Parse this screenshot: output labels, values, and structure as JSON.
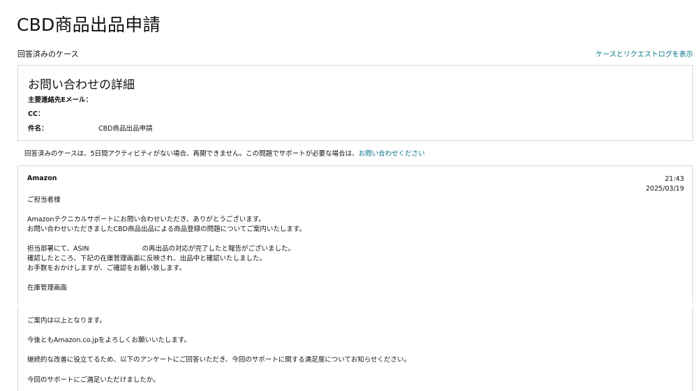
{
  "page": {
    "title": "CBD商品出品申請",
    "status": "回答済みのケース",
    "top_link": "ケースとリクエストログを表示"
  },
  "details": {
    "title": "お問い合わせの詳細",
    "rows": [
      {
        "label": "主要連絡先Eメール：",
        "value": ""
      },
      {
        "label": "CC：",
        "value": ""
      },
      {
        "label": "件名：",
        "value": "CBD商品出品申請"
      }
    ]
  },
  "notice": {
    "text": "回答済みのケースは、5日間アクティビティがない場合、再開できません。この問題でサポートが必要な場合は、",
    "link": "お問い合わせください"
  },
  "message": {
    "sender": "Amazon",
    "time": "21:43",
    "date": "2025/03/19",
    "lines": [
      "ご担当者様",
      "Amazonテクニカルサポートにお問い合わせいただき、ありがとうございます。",
      "お問い合わせいただきましたCBD商品出品による商品登録の問題についてご案内いたします。",
      "担当部署にて、ASIN　　　　　　　　の再出品の対応が完了したと報告がございました。",
      "確認したところ、下記の在庫管理画面に反映され、出品中と確認いたしました。",
      "お手数をおかけしますが、ご確認をお願い致します。",
      "在庫管理画面",
      "ご案内は以上となります。",
      "今後ともAmazon.co.jpをよろしくお願いいたします。",
      "継続的な改善に役立てるため、以下のアンケートにご回答いただき、今回のサポートに関する満足度についてお知らせください。",
      "今回のサポートにご満足いただけましたか。"
    ]
  }
}
